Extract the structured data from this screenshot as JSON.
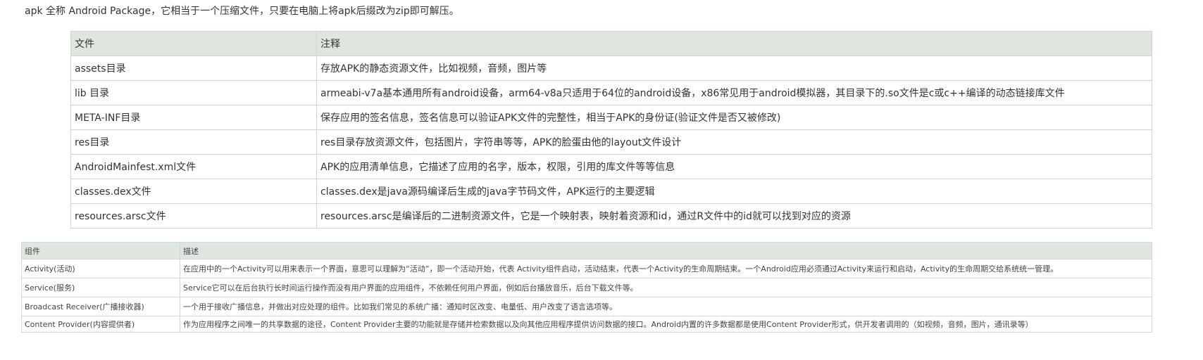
{
  "intro": "apk 全称 Android Package，它相当于一个压缩文件，只要在电脑上将apk后缀改为zip即可解压。",
  "files_table": {
    "headers": [
      "文件",
      "注释"
    ],
    "rows": [
      [
        "assets目录",
        "存放APK的静态资源文件，比如视频，音频，图片等"
      ],
      [
        "lib 目录",
        "armeabi-v7a基本通用所有android设备，arm64-v8a只适用于64位的android设备，x86常见用于android模拟器，其目录下的.so文件是c或c++编译的动态链接库文件"
      ],
      [
        "META-INF目录",
        "保存应用的签名信息，签名信息可以验证APK文件的完整性，相当于APK的身份证(验证文件是否又被修改)"
      ],
      [
        "res目录",
        "res目录存放资源文件，包括图片，字符串等等，APK的脸蛋由他的layout文件设计"
      ],
      [
        "AndroidMainfest.xml文件",
        "APK的应用清单信息，它描述了应用的名字，版本，权限，引用的库文件等等信息"
      ],
      [
        "classes.dex文件",
        "classes.dex是java源码编译后生成的java字节码文件，APK运行的主要逻辑"
      ],
      [
        "resources.arsc文件",
        "resources.arsc是编译后的二进制资源文件，它是一个映射表，映射着资源和id，通过R文件中的id就可以找到对应的资源"
      ]
    ]
  },
  "components_table": {
    "headers": [
      "组件",
      "描述"
    ],
    "rows": [
      [
        "Activity(活动)",
        "在应用中的一个Activity可以用来表示一个界面，意思可以理解为“活动”，即一个活动开始，代表 Activity组件启动，活动结束，代表一个Activity的生命周期结束。一个Android应用必须通过Activity来运行和启动，Activity的生命周期交给系统统一管理。"
      ],
      [
        "Service(服务)",
        "Service它可以在后台执行长时间运行操作而没有用户界面的应用组件，不依赖任何用户界面，例如后台播放音乐，后台下载文件等。"
      ],
      [
        "Broadcast Receiver(广播接收器)",
        "一个用于接收广播信息，并做出对应处理的组件。比如我们常见的系统广播：通知时区改变、电量低、用户改变了语言选项等。"
      ],
      [
        "Content Provider(内容提供者)",
        "作为应用程序之间唯一的共享数据的途径，Content Provider主要的功能就是存储并检索数据以及向其他应用程序提供访问数据的接口。Android内置的许多数据都是使用Content Provider形式，供开发者调用的（如视频，音频，图片，通讯录等）"
      ]
    ]
  }
}
